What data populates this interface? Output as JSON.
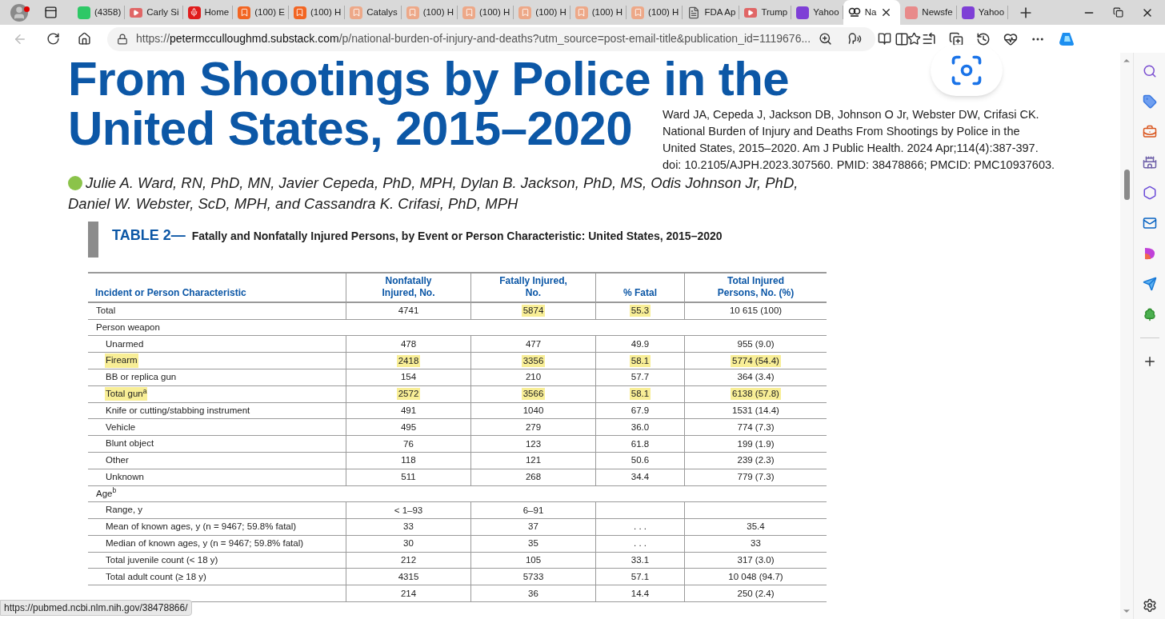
{
  "tabs": [
    {
      "label": "(4358)",
      "kind": "g",
      "selected": false
    },
    {
      "label": "Carly Si",
      "kind": "video",
      "selected": false
    },
    {
      "label": "Home",
      "kind": "mic",
      "selected": false
    },
    {
      "label": "(100) E",
      "kind": "bookmark",
      "selected": false
    },
    {
      "label": "(100) H",
      "kind": "bookmark",
      "selected": false
    },
    {
      "label": "Catalys",
      "kind": "faded",
      "selected": false
    },
    {
      "label": "(100) H",
      "kind": "faded",
      "selected": false
    },
    {
      "label": "(100) H",
      "kind": "faded",
      "selected": false
    },
    {
      "label": "(100) H",
      "kind": "faded",
      "selected": false
    },
    {
      "label": "(100) H",
      "kind": "faded",
      "selected": false
    },
    {
      "label": "(100) H",
      "kind": "faded",
      "selected": false
    },
    {
      "label": "FDA Ap",
      "kind": "page",
      "selected": false
    },
    {
      "label": "Trump",
      "kind": "video",
      "selected": false
    },
    {
      "label": "Yahoo",
      "kind": "purple",
      "selected": false
    },
    {
      "label": "Na",
      "kind": "substack",
      "selected": true
    },
    {
      "label": "Newsfe",
      "kind": "pink",
      "selected": false
    },
    {
      "label": "Yahoo",
      "kind": "purple",
      "selected": false
    }
  ],
  "address": {
    "url_prefix": "https://",
    "url_host": "petermcculloughmd.substack.com",
    "url_path": "/p/national-burden-of-injury-and-deaths?utm_source=post-email-title&publication_id=1119676..."
  },
  "article": {
    "title_lines": [
      "From Shootings by Police in the",
      "United States, 2015–2020"
    ],
    "citation": [
      "Ward JA, Cepeda J, Jackson DB, Johnson O Jr, Webster DW, Crifasi CK.",
      "National Burden of Injury and Deaths From Shootings by Police in the",
      "United States, 2015–2020. Am J Public Health. 2024 Apr;114(4):387-397.",
      "doi: 10.2105/AJPH.2023.307560. PMID: 38478866; PMCID: PMC10937603."
    ],
    "authors": [
      "Julie A. Ward, RN, PhD, MN, Javier Cepeda, PhD, MPH, Dylan B. Jackson, PhD, MS, Odis Johnson Jr, PhD,",
      "Daniel W. Webster, ScD, MPH, and Cassandra K. Crifasi, PhD, MPH"
    ]
  },
  "table": {
    "label": "TABLE 2—",
    "title": "Fatally and Nonfatally Injured Persons, by Event or Person Characteristic: United States, 2015–2020",
    "columns": [
      "Incident or Person Characteristic",
      "Nonfatally Injured, No.",
      "Fatally Injured, No.",
      "% Fatal",
      "Total Injured Persons, No. (%)"
    ],
    "rows": [
      {
        "kind": "data",
        "label": "Total",
        "highlighted": false,
        "cells": [
          {
            "text": "4741",
            "highlighted": false
          },
          {
            "text": "5874",
            "highlighted": true
          },
          {
            "text": "55.3",
            "highlighted": true
          },
          {
            "text": "10 615 (100)",
            "highlighted": false
          }
        ]
      },
      {
        "kind": "section",
        "label": "Person weapon",
        "children": [
          {
            "kind": "data",
            "label": "Unarmed",
            "highlighted": false,
            "cells": [
              {
                "text": "478",
                "highlighted": false
              },
              {
                "text": "477",
                "highlighted": false
              },
              {
                "text": "49.9",
                "highlighted": false
              },
              {
                "text": "955 (9.0)",
                "highlighted": false
              }
            ]
          },
          {
            "kind": "data",
            "label": "Firearm",
            "highlighted": true,
            "cells": [
              {
                "text": "2418",
                "highlighted": true
              },
              {
                "text": "3356",
                "highlighted": true
              },
              {
                "text": "58.1",
                "highlighted": true
              },
              {
                "text": "5774 (54.4)",
                "highlighted": true
              }
            ]
          },
          {
            "kind": "data",
            "label": "BB or replica gun",
            "highlighted": false,
            "cells": [
              {
                "text": "154",
                "highlighted": false
              },
              {
                "text": "210",
                "highlighted": false
              },
              {
                "text": "57.7",
                "highlighted": false
              },
              {
                "text": "364 (3.4)",
                "highlighted": false
              }
            ]
          },
          {
            "kind": "data",
            "label": "Total gun$^{a}$",
            "highlighted": true,
            "cells": [
              {
                "text": "2572",
                "highlighted": true
              },
              {
                "text": "3566",
                "highlighted": true
              },
              {
                "text": "58.1",
                "highlighted": true
              },
              {
                "text": "6138 (57.8)",
                "highlighted": true
              }
            ]
          },
          {
            "kind": "data",
            "label": "Knife or cutting/stabbing instrument",
            "highlighted": false,
            "cells": [
              {
                "text": "491",
                "highlighted": false
              },
              {
                "text": "1040",
                "highlighted": false
              },
              {
                "text": "67.9",
                "highlighted": false
              },
              {
                "text": "1531 (14.4)",
                "highlighted": false
              }
            ]
          },
          {
            "kind": "data",
            "label": "Vehicle",
            "highlighted": false,
            "cells": [
              {
                "text": "495",
                "highlighted": false
              },
              {
                "text": "279",
                "highlighted": false
              },
              {
                "text": "36.0",
                "highlighted": false
              },
              {
                "text": "774 (7.3)",
                "highlighted": false
              }
            ]
          },
          {
            "kind": "data",
            "label": "Blunt object",
            "highlighted": false,
            "cells": [
              {
                "text": "76",
                "highlighted": false
              },
              {
                "text": "123",
                "highlighted": false
              },
              {
                "text": "61.8",
                "highlighted": false
              },
              {
                "text": "199 (1.9)",
                "highlighted": false
              }
            ]
          },
          {
            "kind": "data",
            "label": "Other",
            "highlighted": false,
            "cells": [
              {
                "text": "118",
                "highlighted": false
              },
              {
                "text": "121",
                "highlighted": false
              },
              {
                "text": "50.6",
                "highlighted": false
              },
              {
                "text": "239 (2.3)",
                "highlighted": false
              }
            ]
          },
          {
            "kind": "data",
            "label": "Unknown",
            "highlighted": false,
            "cells": [
              {
                "text": "511",
                "highlighted": false
              },
              {
                "text": "268",
                "highlighted": false
              },
              {
                "text": "34.4",
                "highlighted": false
              },
              {
                "text": "779 (7.3)",
                "highlighted": false
              }
            ]
          }
        ]
      },
      {
        "kind": "section",
        "label": "Age$^{b}$",
        "children": [
          {
            "kind": "data",
            "label": "Range, y",
            "highlighted": false,
            "cells": [
              {
                "text": "< 1–93",
                "highlighted": false
              },
              {
                "text": "6–91",
                "highlighted": false
              }
            ]
          },
          {
            "kind": "data",
            "label": "Mean of known ages, y (n = 9467; 59.8% fatal)",
            "highlighted": false,
            "cells": [
              {
                "text": "33",
                "highlighted": false
              },
              {
                "text": "37",
                "highlighted": false
              },
              {
                "text": ". . .",
                "highlighted": false
              },
              {
                "text": "35.4",
                "highlighted": false
              }
            ]
          },
          {
            "kind": "data",
            "label": "Median of known ages, y (n = 9467; 59.8% fatal)",
            "highlighted": false,
            "cells": [
              {
                "text": "30",
                "highlighted": false
              },
              {
                "text": "35",
                "highlighted": false
              },
              {
                "text": ". . .",
                "highlighted": false
              },
              {
                "text": "33",
                "highlighted": false
              }
            ]
          },
          {
            "kind": "data",
            "label": "Total juvenile count (< 18 y)",
            "highlighted": false,
            "cells": [
              {
                "text": "212",
                "highlighted": false
              },
              {
                "text": "105",
                "highlighted": false
              },
              {
                "text": "33.1",
                "highlighted": false
              },
              {
                "text": "317 (3.0)",
                "highlighted": false
              }
            ]
          },
          {
            "kind": "data",
            "label": "Total adult count (≥ 18 y)",
            "highlighted": false,
            "cells": [
              {
                "text": "4315",
                "highlighted": false
              },
              {
                "text": "5733",
                "highlighted": false
              },
              {
                "text": "57.1",
                "highlighted": false
              },
              {
                "text": "10 048 (94.7)",
                "highlighted": false
              }
            ]
          },
          {
            "kind": "data",
            "cells": [
              {
                "text": "214",
                "highlighted": false
              },
              {
                "text": "36",
                "highlighted": false
              },
              {
                "text": "14.4",
                "highlighted": false
              },
              {
                "text": "250 (2.4)",
                "highlighted": false
              }
            ]
          }
        ]
      }
    ]
  },
  "status_link": "https://pubmed.ncbi.nlm.nih.gov/38478866/"
}
